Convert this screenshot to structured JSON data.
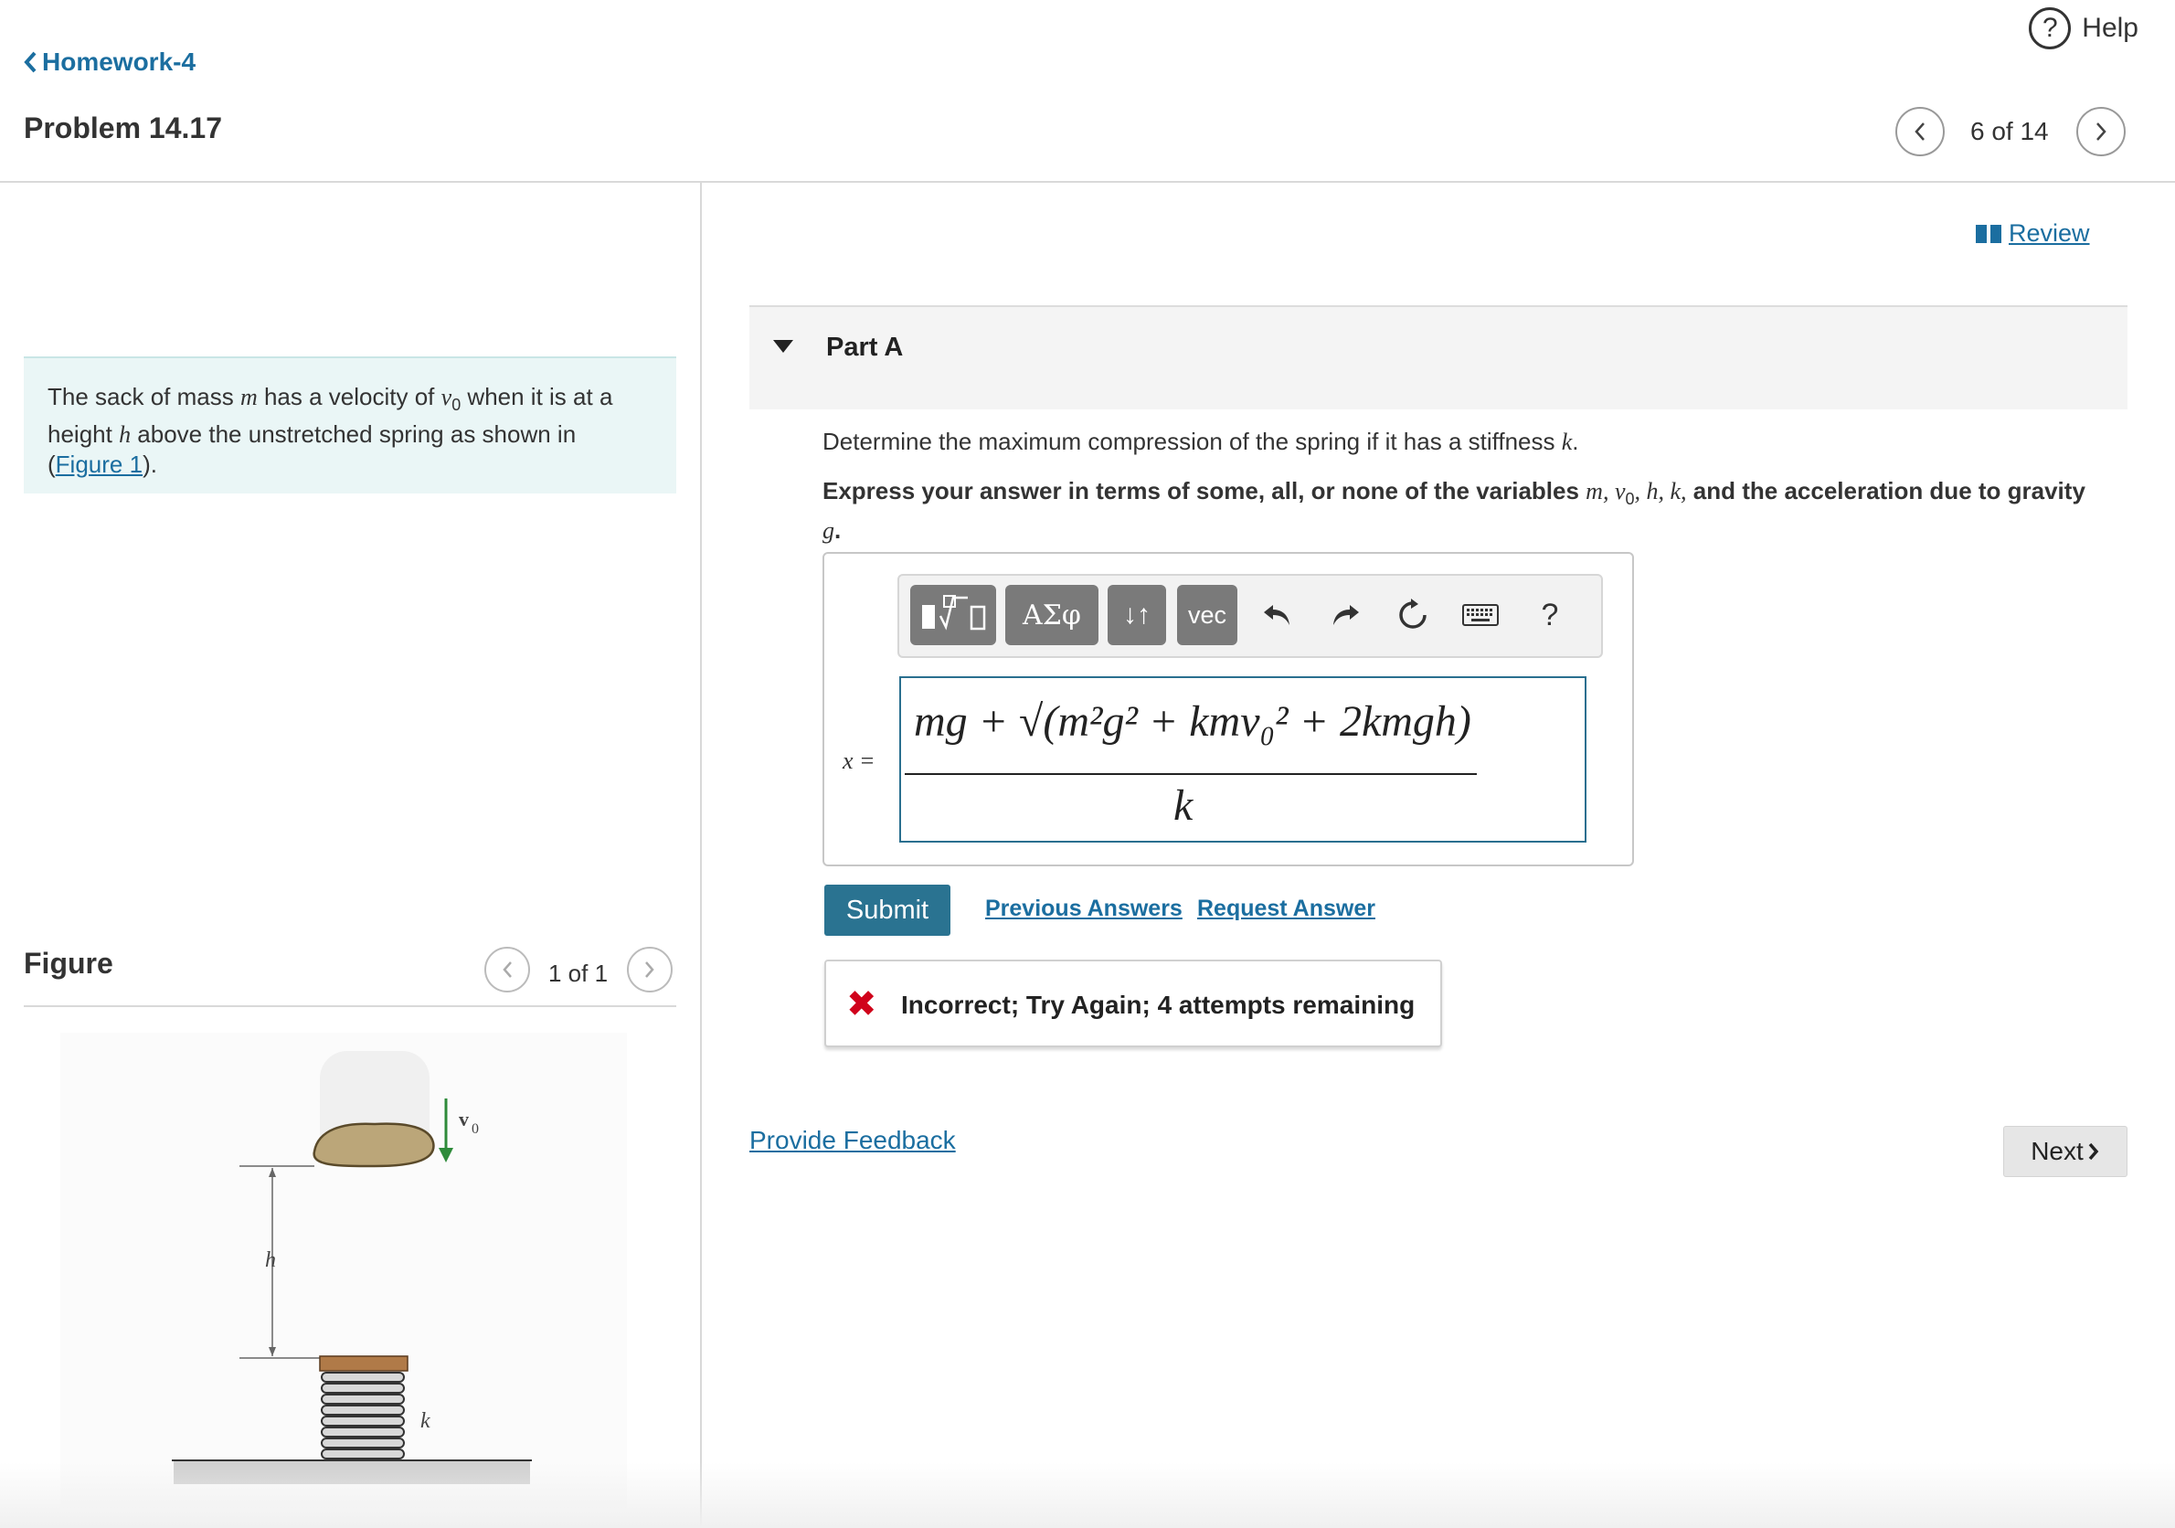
{
  "header": {
    "help_label": "Help",
    "back_label": "Homework-4",
    "problem_title": "Problem 14.17",
    "page_count": "6 of 14"
  },
  "problem": {
    "text_1": "The sack of mass ",
    "var_m": "m",
    "text_2": " has a velocity of ",
    "var_v0": "v",
    "var_v0_sub": "0",
    "text_3": " when it is at a height ",
    "var_h": "h",
    "text_4": " above the unstretched spring as shown in",
    "figure_open": "(",
    "figure_link": "Figure 1",
    "figure_close": ")."
  },
  "figure": {
    "title": "Figure",
    "count": "1 of 1",
    "label_v0": "v",
    "label_v0_sub": "0",
    "label_h": "h",
    "label_k": "k"
  },
  "right": {
    "review_label": "Review",
    "part_title": "Part A",
    "question_text": "Determine the maximum compression of the spring if it has a stiffness ",
    "question_var": "k",
    "question_end": ".",
    "instructions_text": "Express your answer in terms of some, all, or none of the variables ",
    "instructions_vars": "m, v",
    "instructions_sub": "0",
    "instructions_vars2": ", h, k,",
    "instructions_text2": " and the acceleration due to gravity ",
    "instructions_g": "g",
    "instructions_end": "."
  },
  "toolbar": {
    "greek": "ΑΣφ",
    "arrows": "↓↑",
    "vec": "vec",
    "help": "?"
  },
  "answer": {
    "var_label": "x =",
    "numerator": "mg + √(m²g² + kmv₀² + 2kmgh)",
    "denominator": "k"
  },
  "actions": {
    "submit": "Submit",
    "previous_answers": "Previous Answers",
    "request_answer": "Request Answer"
  },
  "feedback": {
    "text": "Incorrect; Try Again; 4 attempts remaining"
  },
  "footer": {
    "provide_feedback": "Provide Feedback",
    "next": "Next"
  },
  "colors": {
    "accent": "#2a7391",
    "link": "#1b6ea0",
    "error": "#d0021b",
    "problem_bg": "#eaf6f6"
  }
}
